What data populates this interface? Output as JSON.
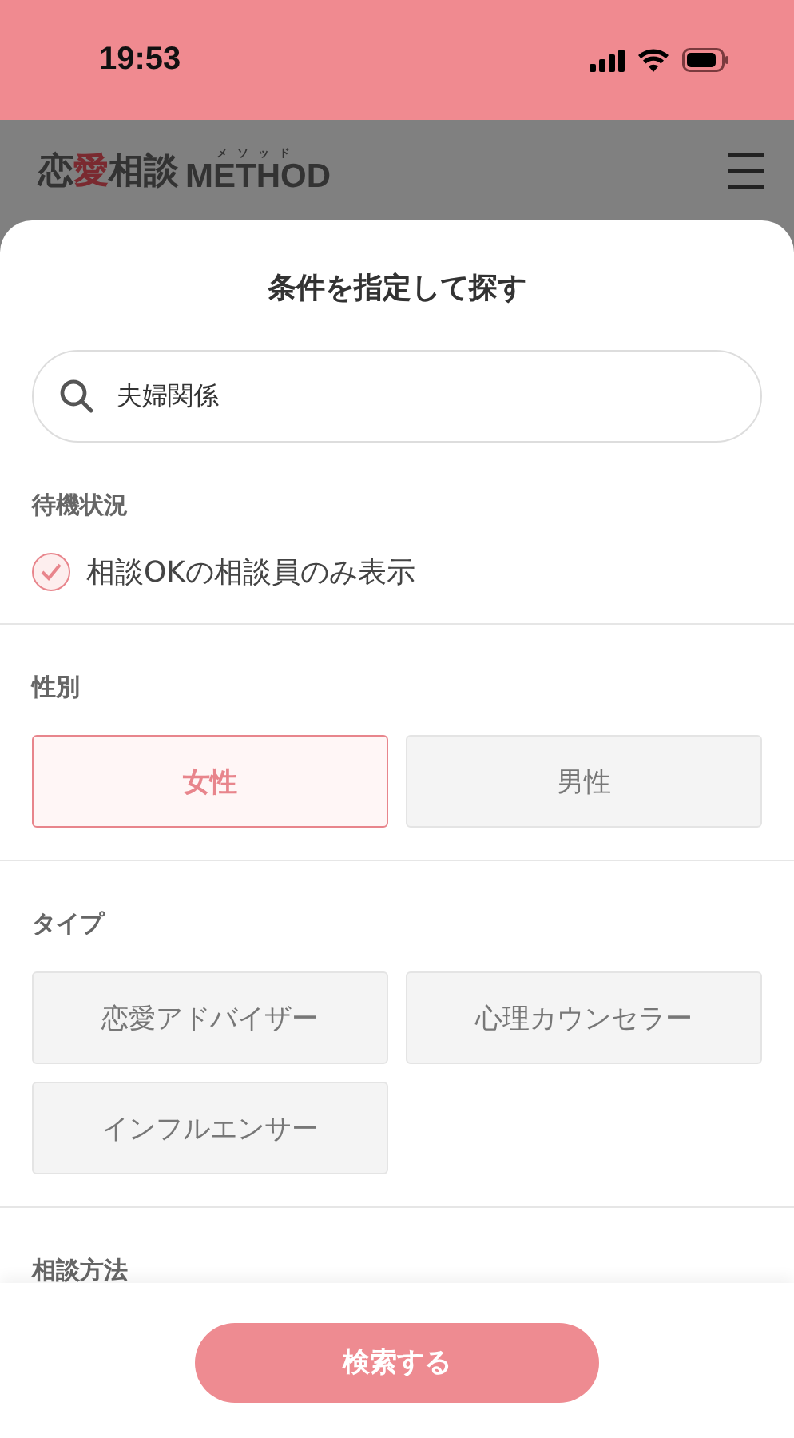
{
  "status_bar": {
    "time": "19:53"
  },
  "header": {
    "logo": {
      "parts": [
        {
          "text": "恋",
          "accent": false
        },
        {
          "text": "愛",
          "accent": true
        },
        {
          "text": "相談",
          "accent": false
        }
      ],
      "ruby": "メソッド",
      "word": "METHOD"
    }
  },
  "sheet": {
    "title": "条件を指定して探す",
    "search": {
      "value": "夫婦関係"
    },
    "sections": [
      {
        "kind": "checks",
        "label": "待機状況",
        "items": [
          {
            "label": "相談OKの相談員のみ表示",
            "checked": true
          }
        ]
      },
      {
        "kind": "choices",
        "label": "性別",
        "items": [
          {
            "label": "女性",
            "selected": true
          },
          {
            "label": "男性",
            "selected": false
          }
        ]
      },
      {
        "kind": "choices",
        "label": "タイプ",
        "items": [
          {
            "label": "恋愛アドバイザー",
            "selected": false
          },
          {
            "label": "心理カウンセラー",
            "selected": false
          },
          {
            "label": "インフルエンサー",
            "selected": false
          }
        ]
      },
      {
        "kind": "heading",
        "label": "相談方法"
      }
    ],
    "submit": "検索する"
  }
}
